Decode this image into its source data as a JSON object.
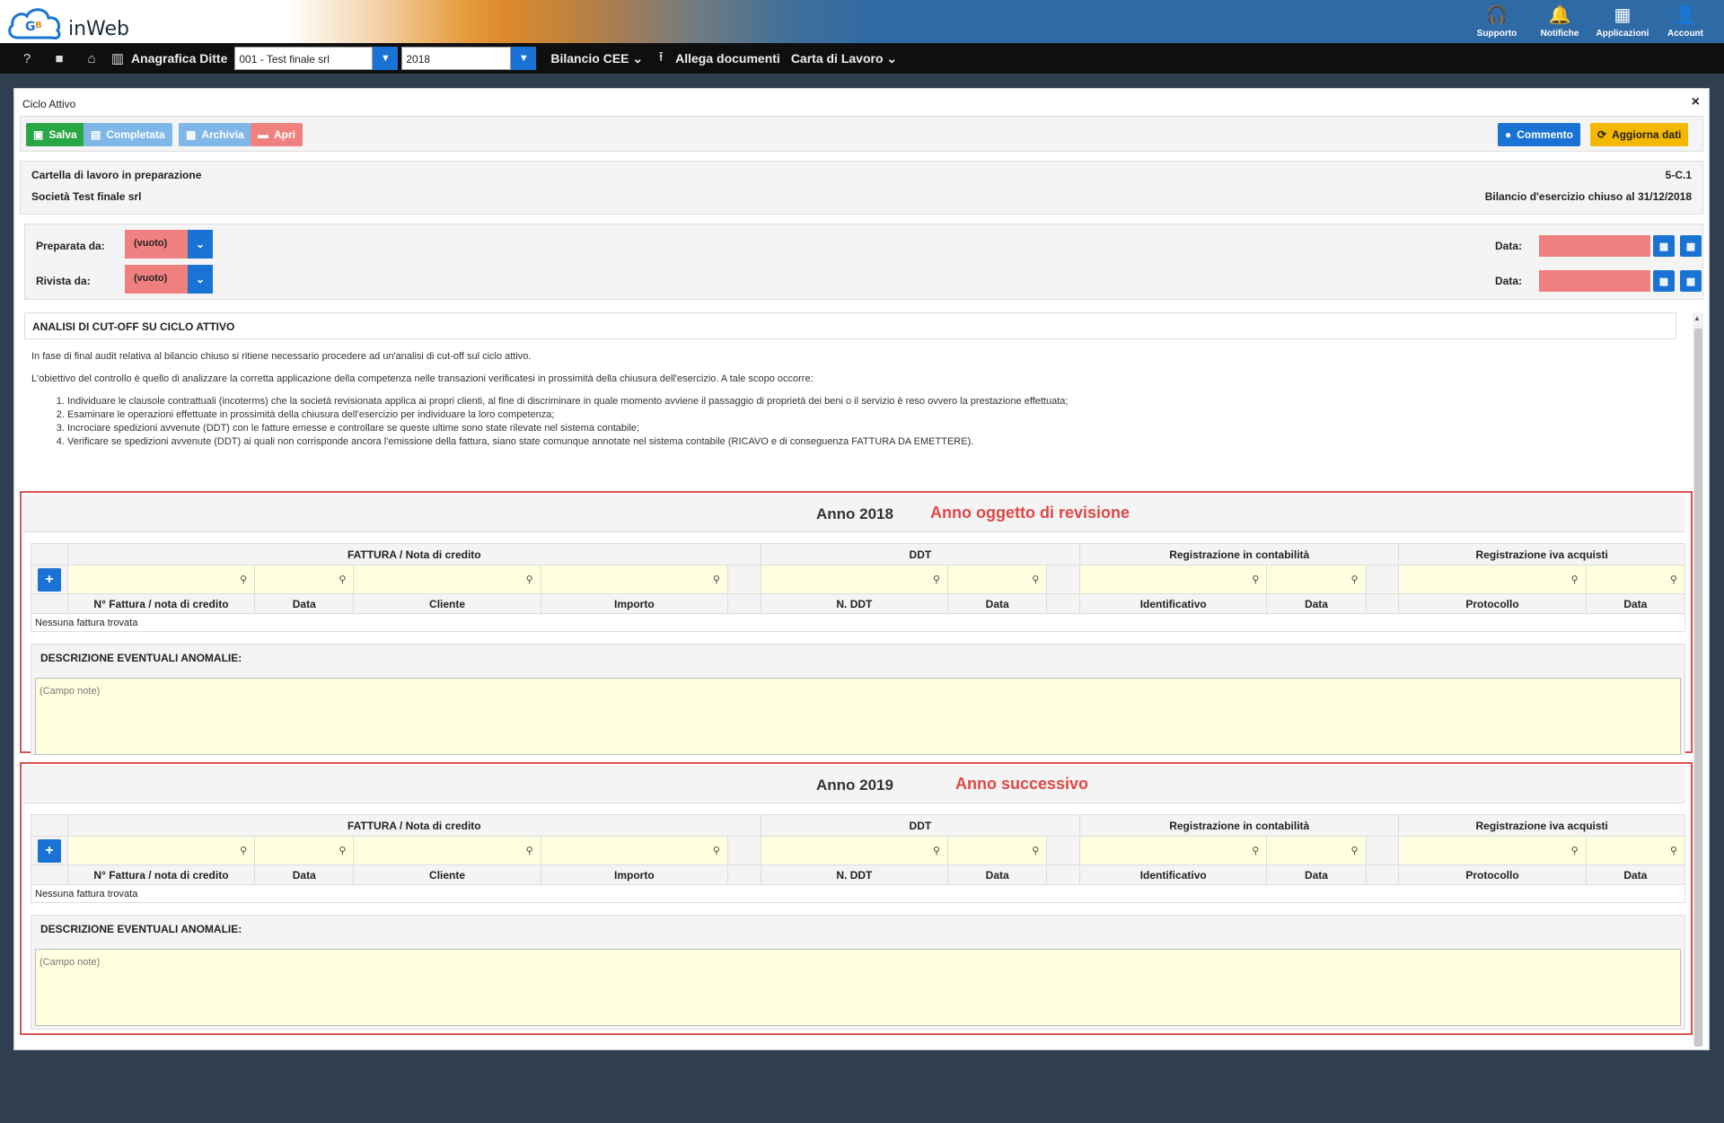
{
  "brand": {
    "name": "inWeb"
  },
  "top_icons": [
    {
      "label": "Supporto",
      "icon": "headset-icon",
      "glyph": "🎧"
    },
    {
      "label": "Notifiche",
      "icon": "bell-icon",
      "glyph": "🔔"
    },
    {
      "label": "Applicazioni",
      "icon": "grid-icon",
      "glyph": "▦"
    },
    {
      "label": "Account",
      "icon": "user-icon",
      "glyph": "👤"
    }
  ],
  "navbar": {
    "company_label": "Anagrafica Ditte",
    "company_value": "001 - Test finale srl",
    "year_value": "2018",
    "menu1": "Bilancio CEE",
    "menu2": "Allega documenti",
    "menu3": "Carta di Lavoro"
  },
  "panel": {
    "title": "Ciclo Attivo",
    "buttons": {
      "salva": "Salva",
      "completata": "Completata",
      "archivia": "Archivia",
      "apri": "Apri",
      "commento": "Commento",
      "aggiorna": "Aggiorna dati"
    },
    "info": {
      "status": "Cartella di lavoro in preparazione",
      "company": "Società Test finale srl",
      "code": "5-C.1",
      "balance": "Bilancio d'esercizio chiuso al 31/12/2018"
    },
    "sign": {
      "prepared_label": "Preparata da:",
      "prepared_value": "(vuoto)",
      "reviewed_label": "Rivista da:",
      "reviewed_value": "(vuoto)",
      "date_label": "Data:"
    }
  },
  "section": {
    "title": "ANALISI DI CUT-OFF SU CICLO ATTIVO",
    "p1": "In fase di final audit relativa al bilancio chiuso si ritiene necessario procedere ad un'analisi di cut-off sul ciclo attivo.",
    "p2": "L'obiettivo del controllo è quello di analizzare la corretta applicazione della competenza nelle transazioni verificatesi in prossimità della chiusura dell'esercizio. A tale scopo occorre:",
    "items": [
      "Individuare le clausole contrattuali (incoterms) che la società revisionata applica ai propri clienti, al fine di discriminare in quale momento avviene il passaggio di proprietà dei beni o il servizio è reso ovvero la prestazione effettuata;",
      "Esaminare le operazioni effettuate in prossimità della chiusura dell'esercizio per individuare la loro competenza;",
      "Incrociare spedizioni avvenute (DDT) con le fatture emesse e controllare se queste ultime sono state rilevate nel sistema contabile;",
      "Verificare se spedizioni avvenute (DDT) ai quali non corrisponde ancora l'emissione della fattura, siano state comunque annotate nel sistema contabile (RICAVO e di conseguenza FATTURA DA EMETTERE)."
    ]
  },
  "table": {
    "groups": [
      "FATTURA / Nota di credito",
      "DDT",
      "Registrazione in contabilità",
      "Registrazione iva acquisti"
    ],
    "columns": [
      "N° Fattura / nota di credito",
      "Data",
      "Cliente",
      "Importo",
      "N. DDT",
      "Data",
      "Identificativo",
      "Data",
      "Protocollo",
      "Data"
    ],
    "empty": "Nessuna fattura trovata",
    "anomalies_title": "DESCRIZIONE EVENTUALI ANOMALIE:",
    "notes_placeholder": "(Campo note)"
  },
  "years": [
    {
      "title": "Anno 2018",
      "note": "Anno oggetto di revisione"
    },
    {
      "title": "Anno 2019",
      "note": "Anno successivo"
    }
  ]
}
